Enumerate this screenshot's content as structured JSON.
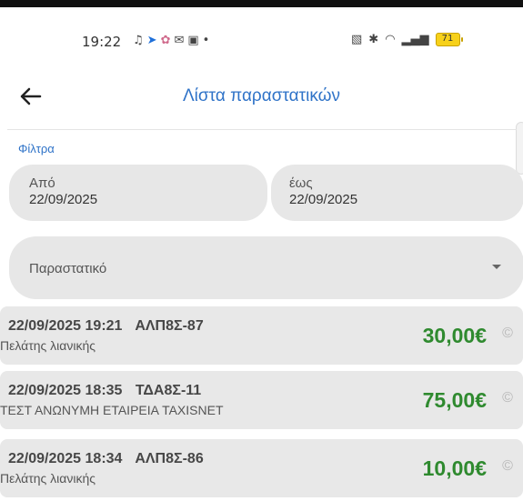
{
  "status_bar": {
    "time": "19:22",
    "left_icons": [
      "notification-icon",
      "location-icon",
      "app-icon",
      "message-icon",
      "screenshot-icon",
      "dot-icon"
    ],
    "right_icons": [
      "nfc-icon",
      "bluetooth-icon",
      "wifi-icon",
      "signal-icon"
    ],
    "battery": "71"
  },
  "app_bar": {
    "title": "Λίστα παραστατικών"
  },
  "filters": {
    "label": "Φίλτρα",
    "from_caption": "Από",
    "from_value": "22/09/2025",
    "to_caption": "έως",
    "to_value": "22/09/2025",
    "document_select": "Παραστατικό"
  },
  "receipts": [
    {
      "date": "22/09/2025 19:21",
      "code": "ΑΛΠ8Σ-87",
      "customer": "Πελάτης λιανικής",
      "amount": "30,00€"
    },
    {
      "date": "22/09/2025 18:35",
      "code": "ΤΔΑ8Σ-11",
      "customer": "ΤΕΣΤ ΑΝΩΝΥΜΗ ΕΤΑΙΡΕΙΑ TAXISNET",
      "amount": "75,00€"
    },
    {
      "date": "22/09/2025 18:34",
      "code": "ΑΛΠ8Σ-86",
      "customer": "Πελάτης λιανικής",
      "amount": "10,00€"
    }
  ],
  "colors": {
    "accent": "#2f73c8",
    "amount": "#2f8a2f",
    "field_background": "#e7e7e7"
  }
}
